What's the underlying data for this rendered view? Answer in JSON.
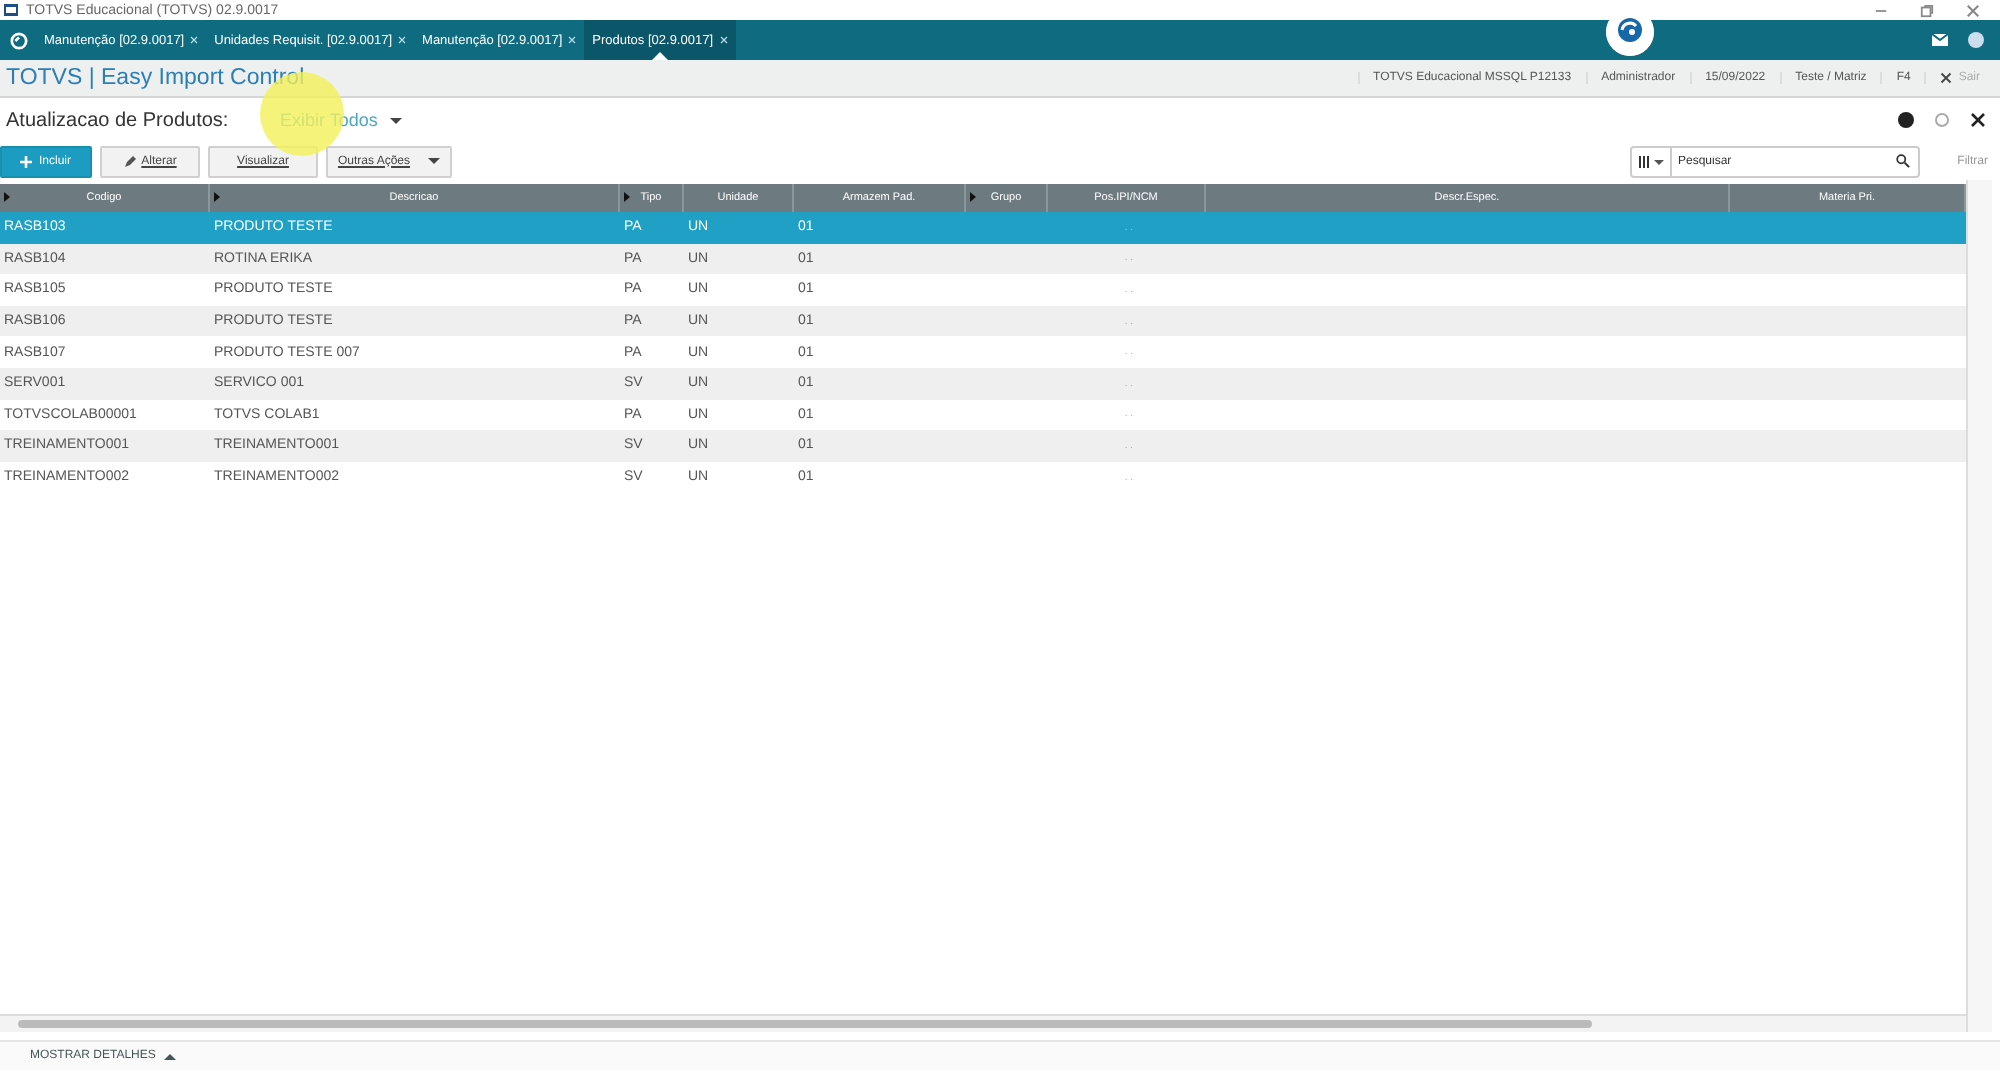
{
  "window": {
    "title": "TOTVS Educacional (TOTVS) 02.9.0017"
  },
  "tabs": [
    {
      "label": "Manutenção [02.9.0017]",
      "selected": false
    },
    {
      "label": "Unidades Requisit. [02.9.0017]",
      "selected": false
    },
    {
      "label": "Manutenção [02.9.0017]",
      "selected": false
    },
    {
      "label": "Produtos [02.9.0017]",
      "selected": true
    }
  ],
  "header": {
    "title": "TOTVS | Easy Import Control",
    "info": [
      "TOTVS Educacional MSSQL P12133",
      "Administrador",
      "15/09/2022",
      "Teste / Matriz",
      "F4"
    ],
    "exit": "Sair"
  },
  "page": {
    "title": "Atualizacao de Produtos:",
    "view": "Exibir Todos"
  },
  "toolbar": {
    "buttons": [
      {
        "label": "Incluir",
        "kind": "primary"
      },
      {
        "label": "Alterar",
        "kind": "edit"
      },
      {
        "label": "Visualizar",
        "kind": "plain"
      },
      {
        "label": "Outras Ações",
        "kind": "menu"
      }
    ],
    "search": {
      "placeholder": "Pesquisar"
    },
    "filter": "Filtrar"
  },
  "table": {
    "columns": [
      {
        "label": "Codigo",
        "arrow": true
      },
      {
        "label": "Descricao",
        "arrow": true
      },
      {
        "label": "Tipo",
        "arrow": true
      },
      {
        "label": "Unidade",
        "arrow": false
      },
      {
        "label": "Armazem Pad.",
        "arrow": false
      },
      {
        "label": "Grupo",
        "arrow": true
      },
      {
        "label": "Pos.IPI/NCM",
        "arrow": false
      },
      {
        "label": "Descr.Espec.",
        "arrow": false
      },
      {
        "label": "Materia Pri.",
        "arrow": false
      }
    ],
    "rows": [
      {
        "selected": true,
        "cells": [
          "RASB103",
          "PRODUTO TESTE",
          "PA",
          "UN",
          "01",
          "",
          ". .",
          "",
          ""
        ]
      },
      {
        "selected": false,
        "cells": [
          "RASB104",
          "ROTINA ERIKA",
          "PA",
          "UN",
          "01",
          "",
          ". .",
          "",
          ""
        ]
      },
      {
        "selected": false,
        "cells": [
          "RASB105",
          "PRODUTO TESTE",
          "PA",
          "UN",
          "01",
          "",
          ". .",
          "",
          ""
        ]
      },
      {
        "selected": false,
        "cells": [
          "RASB106",
          "PRODUTO TESTE",
          "PA",
          "UN",
          "01",
          "",
          ". .",
          "",
          ""
        ]
      },
      {
        "selected": false,
        "cells": [
          "RASB107",
          "PRODUTO TESTE 007",
          "PA",
          "UN",
          "01",
          "",
          ". .",
          "",
          ""
        ]
      },
      {
        "selected": false,
        "cells": [
          "SERV001",
          "SERVICO 001",
          "SV",
          "UN",
          "01",
          "",
          ". .",
          "",
          ""
        ]
      },
      {
        "selected": false,
        "cells": [
          "TOTVSCOLAB00001",
          "TOTVS COLAB1",
          "PA",
          "UN",
          "01",
          "",
          ". .",
          "",
          ""
        ]
      },
      {
        "selected": false,
        "cells": [
          "TREINAMENTO001",
          "TREINAMENTO001",
          "SV",
          "UN",
          "01",
          "",
          ". .",
          "",
          ""
        ]
      },
      {
        "selected": false,
        "cells": [
          "TREINAMENTO002",
          "TREINAMENTO002",
          "SV",
          "UN",
          "01",
          "",
          ". .",
          "",
          ""
        ]
      }
    ]
  },
  "footer": {
    "details": "MOSTRAR DETALHES"
  }
}
